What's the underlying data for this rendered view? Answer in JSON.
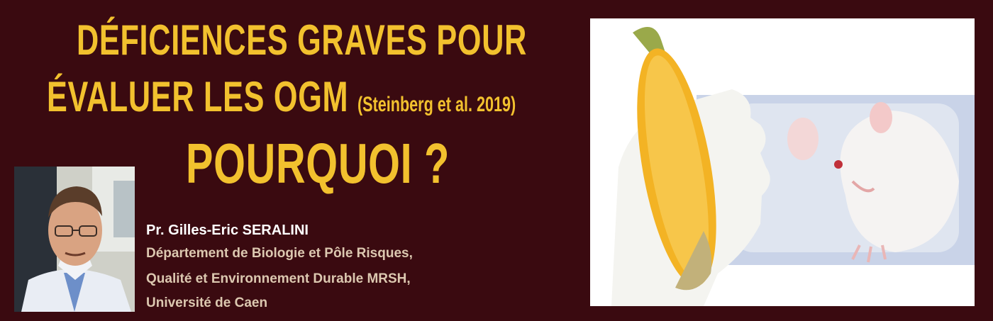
{
  "headline": {
    "line1": "DÉFICIENCES GRAVES POUR",
    "line2": "ÉVALUER LES OGM",
    "citation": "(Steinberg et al. 2019)",
    "line3": "POURQUOI ?"
  },
  "author": {
    "name": "Pr. Gilles-Eric SERALINI",
    "affiliation_lines": [
      "Département de Biologie et Pôle Risques,",
      "Qualité et Environnement Durable MRSH,",
      "Université de Caen"
    ]
  },
  "colors": {
    "background": "#3a0a10",
    "title": "#f2c12e",
    "affiliation": "#dcc8b0"
  },
  "images": {
    "portrait": "man-with-glasses-portrait",
    "photo": "gloved-hand-holding-corn-and-white-rat"
  }
}
